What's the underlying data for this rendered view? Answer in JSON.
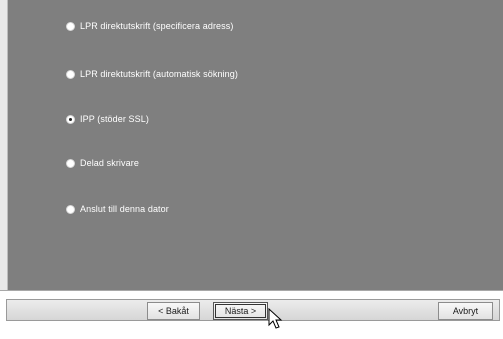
{
  "options": [
    {
      "label": "LPR direktutskrift (specificera adress)",
      "selected": false
    },
    {
      "label": "LPR direktutskrift (automatisk sökning)",
      "selected": false
    },
    {
      "label": "IPP (stöder SSL)",
      "selected": true
    },
    {
      "label": "Delad skrivare",
      "selected": false
    },
    {
      "label": "Anslut till denna dator",
      "selected": false
    }
  ],
  "buttons": {
    "back": "< Bakåt",
    "next": "Nästa >",
    "cancel": "Avbryt"
  },
  "colors": {
    "panel_bg": "#7f7f7f",
    "option_text": "#ffffff"
  },
  "icons": {
    "cursor": "arrow-pointer-icon"
  }
}
